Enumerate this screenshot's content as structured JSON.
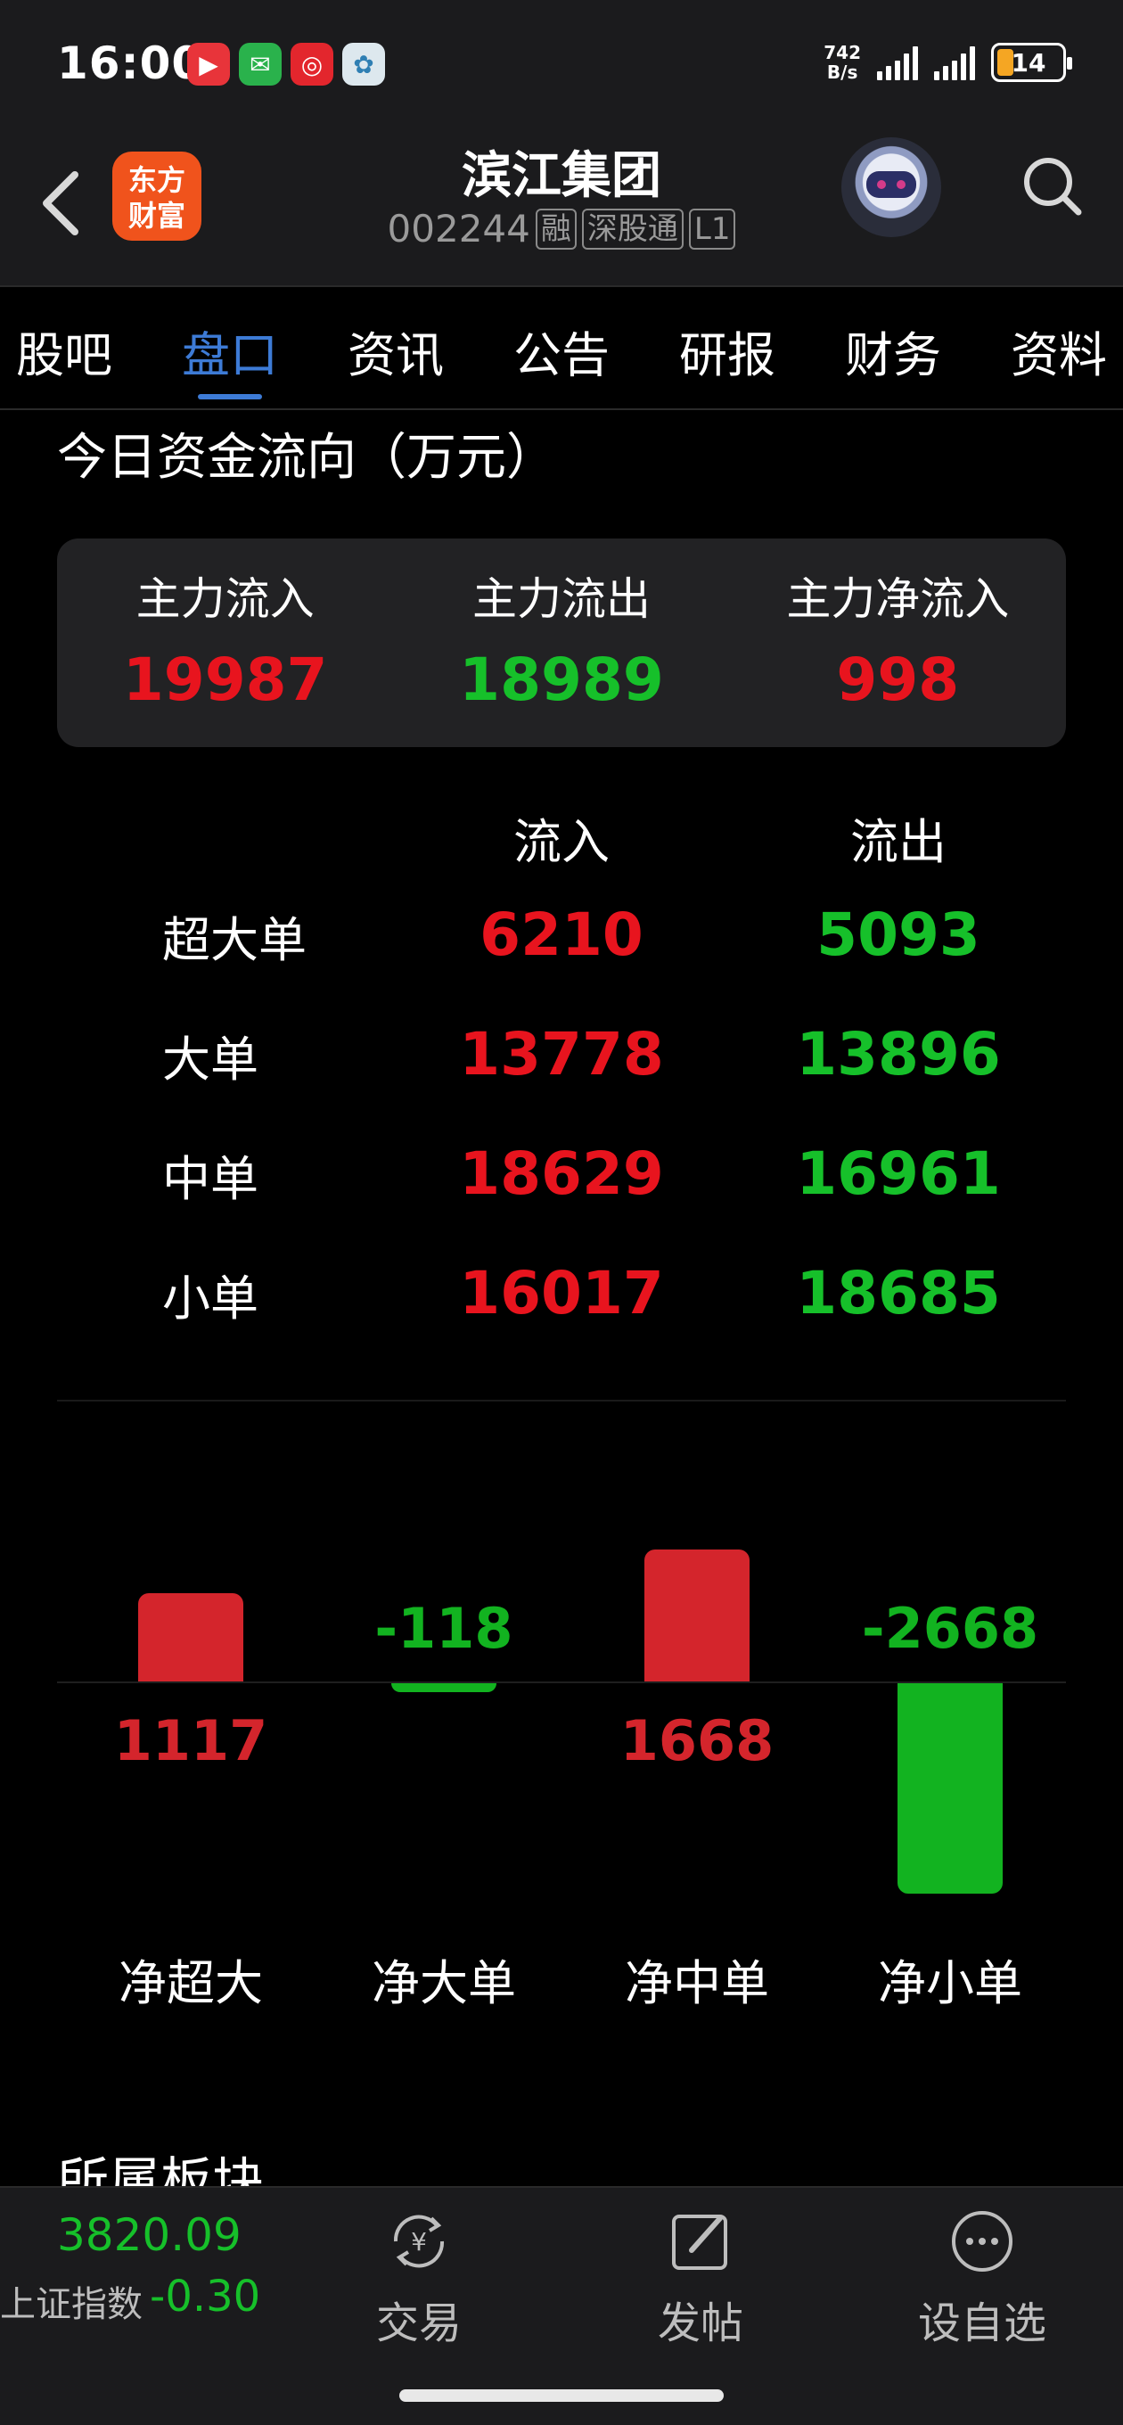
{
  "status_bar": {
    "time": "16:00",
    "net_speed_value": "742",
    "net_speed_unit": "B/s",
    "battery": "14"
  },
  "header": {
    "logo_line1": "东方",
    "logo_line2": "财富",
    "stock_name": "滨江集团",
    "stock_code": "002244",
    "tag_margin": "融",
    "tag_connect": "深股通",
    "tag_level": "L1"
  },
  "tabs": [
    "股吧",
    "盘口",
    "资讯",
    "公告",
    "研报",
    "财务",
    "资料"
  ],
  "active_tab": "盘口",
  "section_title": "今日资金流向（万元）",
  "summary": {
    "inflow_label": "主力流入",
    "inflow_value": "19987",
    "outflow_label": "主力流出",
    "outflow_value": "18989",
    "net_label": "主力净流入",
    "net_value": "998"
  },
  "flow_table": {
    "header_in": "流入",
    "header_out": "流出",
    "rows": [
      {
        "label": "超大单",
        "in": "6210",
        "out": "5093"
      },
      {
        "label": "大单",
        "in": "13778",
        "out": "13896"
      },
      {
        "label": "中单",
        "in": "18629",
        "out": "16961"
      },
      {
        "label": "小单",
        "in": "16017",
        "out": "18685"
      }
    ]
  },
  "chart_data": {
    "type": "bar",
    "categories": [
      "净超大",
      "净大单",
      "净中单",
      "净小单"
    ],
    "values": [
      1117,
      -118,
      1668,
      -2668
    ],
    "value_labels": [
      "1117",
      "-118",
      "1668",
      "-2668"
    ],
    "colors": {
      "positive": "#d4252c",
      "negative": "#12b320"
    }
  },
  "next_section_title": "所属板块",
  "bottom_bar": {
    "index_value": "3820.09",
    "index_name": "上证指数",
    "index_change": "-0.30",
    "trade_label": "交易",
    "post_label": "发帖",
    "watchlist_label": "设自选"
  },
  "colors": {
    "up": "#e8141e",
    "down": "#16c02a",
    "accent": "#3d7bd6",
    "background": "#000000",
    "panel": "#1b1b1d"
  }
}
